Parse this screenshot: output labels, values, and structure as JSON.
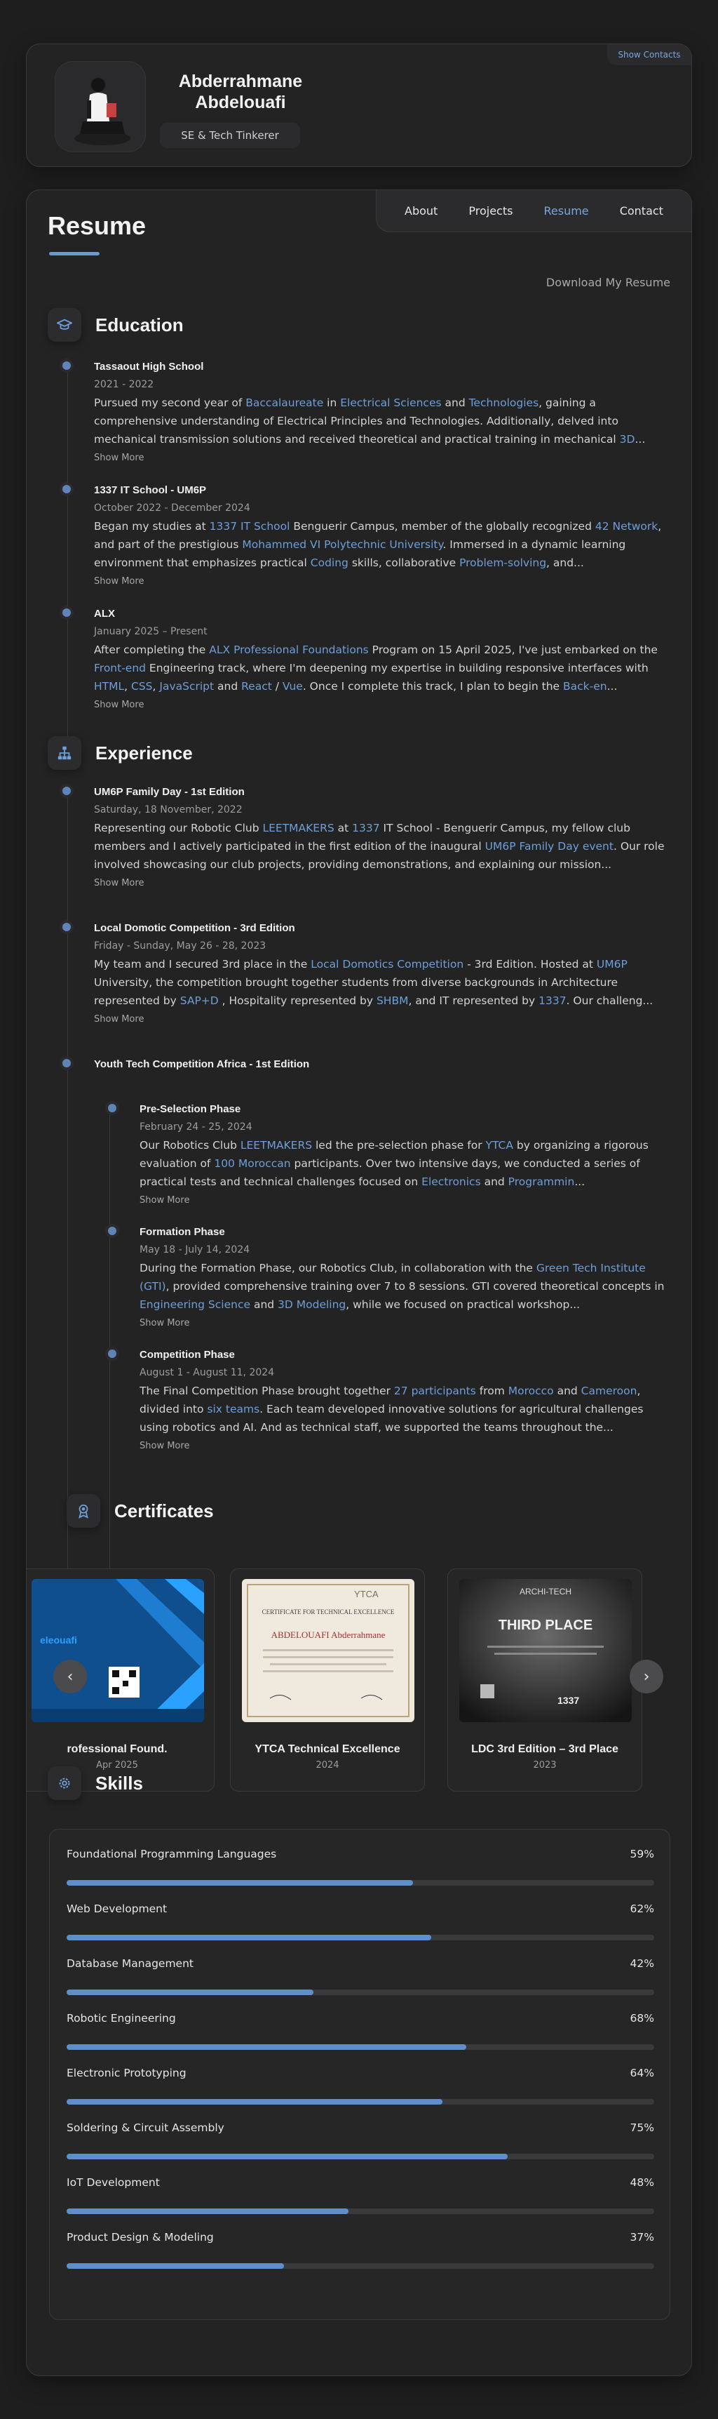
{
  "profile": {
    "name": "Abderrahmane Abdelouafi",
    "title": "SE & Tech Tinkerer",
    "show_contacts": "Show Contacts"
  },
  "nav": [
    "About",
    "Projects",
    "Resume",
    "Contact"
  ],
  "nav_active": "Resume",
  "page": {
    "title": "Resume",
    "download": "Download My Resume"
  },
  "education": {
    "title": "Education",
    "icon": "graduation-cap-icon",
    "items": [
      {
        "title": "Tassaout High School",
        "date": "2021 - 2022",
        "segments": [
          [
            "Pursued my second year of ",
            false
          ],
          [
            "Baccalaureate",
            true
          ],
          [
            " in ",
            false
          ],
          [
            "Electrical Sciences",
            true
          ],
          [
            " and ",
            false
          ],
          [
            "Technologies",
            true
          ],
          [
            ", gaining a comprehensive understanding of Electrical Principles and Technologies. Additionally, delved into mechanical transmission solutions and received theoretical and practical training in mechanical ",
            false
          ],
          [
            "3D",
            true
          ],
          [
            "...",
            false
          ]
        ],
        "more": "Show More"
      },
      {
        "title": "1337 IT School - UM6P",
        "date": "October 2022 - December 2024",
        "segments": [
          [
            "Began my studies at ",
            false
          ],
          [
            "1337 IT School",
            true
          ],
          [
            " Benguerir Campus, member of the globally recognized ",
            false
          ],
          [
            "42 Network",
            true
          ],
          [
            ", and part of the prestigious ",
            false
          ],
          [
            "Mohammed VI Polytechnic University",
            true
          ],
          [
            ". Immersed in a dynamic learning environment that emphasizes practical ",
            false
          ],
          [
            "Coding",
            true
          ],
          [
            " skills, collaborative ",
            false
          ],
          [
            "Problem-solving",
            true
          ],
          [
            ", and...",
            false
          ]
        ],
        "more": "Show More"
      },
      {
        "title": "ALX",
        "date": "January 2025 – Present",
        "segments": [
          [
            "After completing the ",
            false
          ],
          [
            "ALX Professional Foundations",
            true
          ],
          [
            " Program on 15 April 2025, I've just embarked on the ",
            false
          ],
          [
            "Front-end",
            true
          ],
          [
            " Engineering track, where I'm deepening my expertise in building responsive interfaces with ",
            false
          ],
          [
            "HTML",
            true
          ],
          [
            ", ",
            false
          ],
          [
            "CSS",
            true
          ],
          [
            ", ",
            false
          ],
          [
            "JavaScript",
            true
          ],
          [
            " and ",
            false
          ],
          [
            "React",
            true
          ],
          [
            " / ",
            false
          ],
          [
            "Vue",
            true
          ],
          [
            ". Once I complete this track, I plan to begin the ",
            false
          ],
          [
            "Back-en",
            true
          ],
          [
            "...",
            false
          ]
        ],
        "more": "Show More"
      }
    ]
  },
  "experience": {
    "title": "Experience",
    "icon": "sitemap-icon",
    "items": [
      {
        "title": "UM6P Family Day - 1st Edition",
        "date": "Saturday, 18 November, 2022",
        "segments": [
          [
            "Representing our Robotic Club ",
            false
          ],
          [
            "LEETMAKERS",
            true
          ],
          [
            " at ",
            false
          ],
          [
            "1337",
            true
          ],
          [
            " IT School - Benguerir Campus, my fellow club members and I actively participated in the first edition of the inaugural ",
            false
          ],
          [
            "UM6P Family Day event",
            true
          ],
          [
            ". Our role involved showcasing our club projects, providing demonstrations, and explaining our mission...",
            false
          ]
        ],
        "more": "Show More"
      },
      {
        "title": "Local Domotic Competition - 3rd Edition",
        "date": "Friday - Sunday, May 26 - 28, 2023",
        "segments": [
          [
            "My team and I secured 3rd place in the ",
            false
          ],
          [
            "Local Domotics Competition",
            true
          ],
          [
            " - 3rd Edition. Hosted at ",
            false
          ],
          [
            "UM6P",
            true
          ],
          [
            " University, the competition brought together students from diverse backgrounds in Architecture represented by ",
            false
          ],
          [
            "SAP+D",
            true
          ],
          [
            " , Hospitality represented by ",
            false
          ],
          [
            "SHBM",
            true
          ],
          [
            ", and IT represented by ",
            false
          ],
          [
            "1337",
            true
          ],
          [
            ". Our challeng...",
            false
          ]
        ],
        "more": "Show More"
      },
      {
        "title": "Youth Tech Competition Africa - 1st Edition",
        "phases": [
          {
            "title": "Pre-Selection Phase",
            "date": "February 24 - 25, 2024",
            "segments": [
              [
                "Our Robotics Club ",
                false
              ],
              [
                "LEETMAKERS",
                true
              ],
              [
                " led the pre-selection phase for ",
                false
              ],
              [
                "YTCA",
                true
              ],
              [
                " by organizing a rigorous evaluation of ",
                false
              ],
              [
                "100 Moroccan",
                true
              ],
              [
                " participants. Over two intensive days, we conducted a series of practical tests and technical challenges focused on ",
                false
              ],
              [
                "Electronics",
                true
              ],
              [
                " and ",
                false
              ],
              [
                "Programmin",
                true
              ],
              [
                "...",
                false
              ]
            ],
            "more": "Show More"
          },
          {
            "title": "Formation Phase",
            "date": "May 18 - July 14, 2024",
            "segments": [
              [
                "During the Formation Phase, our Robotics Club, in collaboration with the ",
                false
              ],
              [
                "Green Tech Institute (GTI)",
                true
              ],
              [
                ", provided comprehensive training over 7 to 8 sessions. GTI covered theoretical concepts in ",
                false
              ],
              [
                "Engineering Science",
                true
              ],
              [
                " and ",
                false
              ],
              [
                "3D Modeling",
                true
              ],
              [
                ", while we focused on practical workshop...",
                false
              ]
            ],
            "more": "Show More"
          },
          {
            "title": "Competition Phase",
            "date": "August 1 - August 11, 2024",
            "segments": [
              [
                "The Final Competition Phase brought together ",
                false
              ],
              [
                "27 participants",
                true
              ],
              [
                " from ",
                false
              ],
              [
                "Morocco",
                true
              ],
              [
                " and ",
                false
              ],
              [
                "Cameroon",
                true
              ],
              [
                ", divided into ",
                false
              ],
              [
                "six teams",
                true
              ],
              [
                ". Each team developed innovative solutions for agricultural challenges using robotics and AI. And as technical staff, we supported the teams throughout the...",
                false
              ]
            ],
            "more": "Show More"
          }
        ]
      }
    ]
  },
  "certificates": {
    "title": "Certificates",
    "icon": "certificate-icon",
    "cards": [
      {
        "title": "rofessional Found.",
        "date": "Apr 2025"
      },
      {
        "title": "YTCA Technical Excellence",
        "date": "2024"
      },
      {
        "title": "LDC 3rd Edition – 3rd Place",
        "date": "2023"
      }
    ],
    "cert_texts": {
      "alx": "eleouafi",
      "ytca_badge": "YTCA",
      "ytca_heading": "CERTIFICATE FOR TECHNICAL EXCELLENCE",
      "ytca_name": "ABDELOUAFI Abderrahmane",
      "ldc_brand": "ARCHI-TECH",
      "ldc_place": "THIRD PLACE",
      "ldc_num": "1337"
    }
  },
  "skills": {
    "title": "Skills",
    "icon": "gear-icon",
    "items": [
      {
        "name": "Foundational Programming Languages",
        "pct": "59%",
        "value": 59
      },
      {
        "name": "Web Development",
        "pct": "62%",
        "value": 62
      },
      {
        "name": "Database Management",
        "pct": "42%",
        "value": 42
      },
      {
        "name": "Robotic Engineering",
        "pct": "68%",
        "value": 68
      },
      {
        "name": "Electronic Prototyping",
        "pct": "64%",
        "value": 64
      },
      {
        "name": "Soldering & Circuit Assembly",
        "pct": "75%",
        "value": 75
      },
      {
        "name": "IoT Development",
        "pct": "48%",
        "value": 48
      },
      {
        "name": "Product Design & Modeling",
        "pct": "37%",
        "value": 37
      }
    ]
  },
  "colors": {
    "accent": "#6e9fd8",
    "bg": "#1e1e1f",
    "panel": "#232324"
  }
}
